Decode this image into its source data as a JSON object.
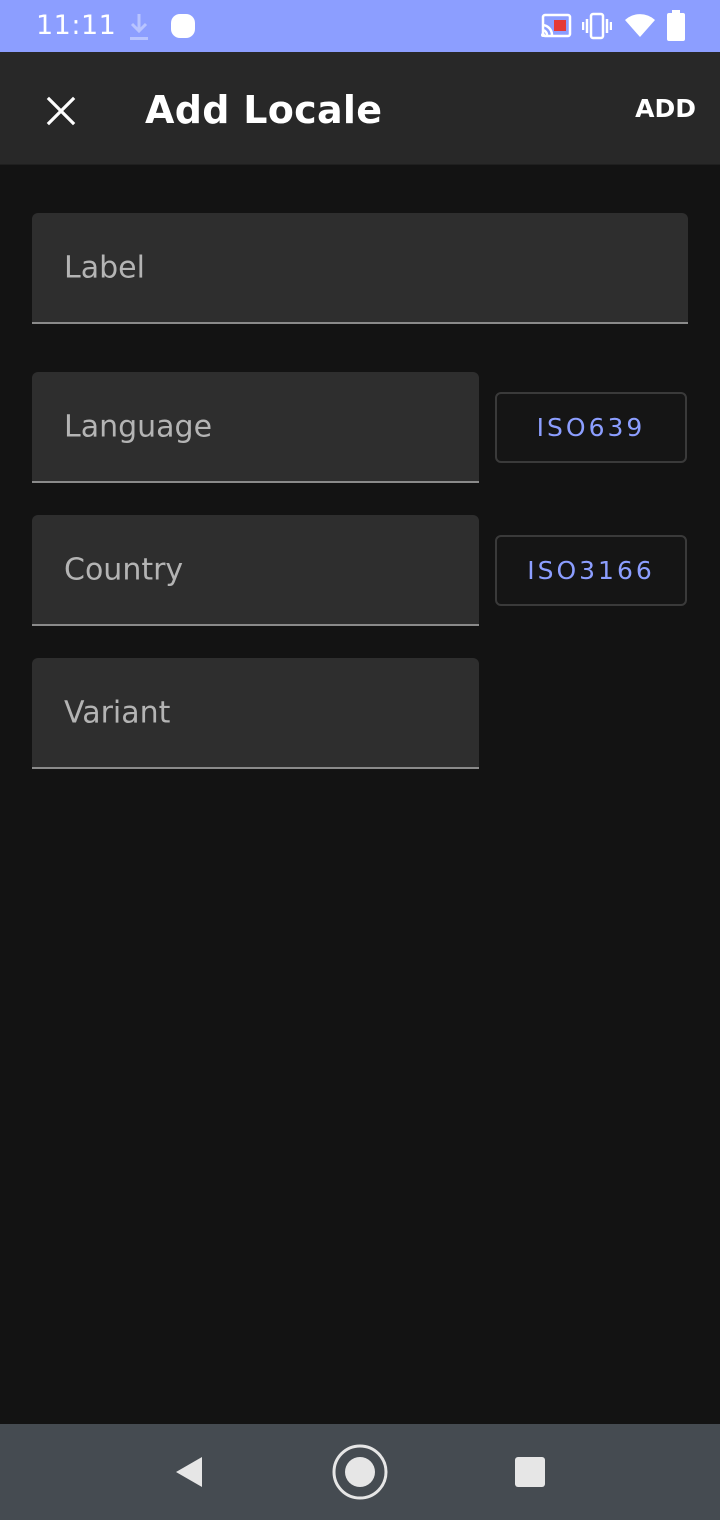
{
  "status_bar": {
    "time": "11:11",
    "icons": [
      "download-icon",
      "notification-dot-icon",
      "cast-icon",
      "vibrate-icon",
      "wifi-icon",
      "battery-icon"
    ],
    "background": "#8c9eff"
  },
  "app_bar": {
    "title": "Add Locale",
    "action_label": "ADD",
    "close_icon": "close-icon"
  },
  "form": {
    "label_placeholder": "Label",
    "language_placeholder": "Language",
    "country_placeholder": "Country",
    "variant_placeholder": "Variant",
    "iso639_label": "ISO639",
    "iso3166_label": "ISO3166",
    "accent_color": "#8c9eff"
  },
  "nav_bar": {
    "icons": [
      "back-icon",
      "home-icon",
      "recents-icon"
    ]
  }
}
